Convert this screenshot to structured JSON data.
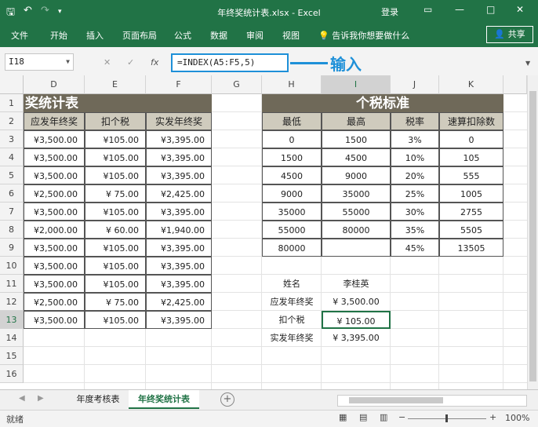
{
  "window": {
    "title": "年终奖统计表.xlsx - Excel",
    "login": "登录",
    "quick_access": [
      "save-icon",
      "undo-icon",
      "redo-icon",
      "customize-icon"
    ]
  },
  "ribbon": {
    "tabs": [
      "文件",
      "开始",
      "插入",
      "页面布局",
      "公式",
      "数据",
      "审阅",
      "视图"
    ],
    "tell_me": "告诉我你想要做什么",
    "share": "共享"
  },
  "formula_bar": {
    "name_box": "I18",
    "formula": "=INDEX(A5:F5,5)",
    "fx": "fx",
    "callout": "输入"
  },
  "columns": [
    "D",
    "E",
    "F",
    "G",
    "H",
    "I",
    "J",
    "K"
  ],
  "rows": [
    "1",
    "2",
    "3",
    "4",
    "5",
    "6",
    "7",
    "8",
    "9",
    "10",
    "11",
    "12",
    "13",
    "14",
    "15",
    "16"
  ],
  "left_table": {
    "banner": "奖统计表",
    "headers": [
      "应发年终奖",
      "扣个税",
      "实发年终奖"
    ],
    "rows": [
      [
        "¥3,500.00",
        "¥105.00",
        "¥3,395.00"
      ],
      [
        "¥3,500.00",
        "¥105.00",
        "¥3,395.00"
      ],
      [
        "¥3,500.00",
        "¥105.00",
        "¥3,395.00"
      ],
      [
        "¥2,500.00",
        "¥ 75.00",
        "¥2,425.00"
      ],
      [
        "¥3,500.00",
        "¥105.00",
        "¥3,395.00"
      ],
      [
        "¥2,000.00",
        "¥ 60.00",
        "¥1,940.00"
      ],
      [
        "¥3,500.00",
        "¥105.00",
        "¥3,395.00"
      ],
      [
        "¥3,500.00",
        "¥105.00",
        "¥3,395.00"
      ],
      [
        "¥3,500.00",
        "¥105.00",
        "¥3,395.00"
      ],
      [
        "¥2,500.00",
        "¥ 75.00",
        "¥2,425.00"
      ],
      [
        "¥3,500.00",
        "¥105.00",
        "¥3,395.00"
      ]
    ]
  },
  "tax_table": {
    "banner": "个税标准",
    "headers": [
      "最低",
      "最高",
      "税率",
      "速算扣除数"
    ],
    "rows": [
      [
        "0",
        "1500",
        "3%",
        "0"
      ],
      [
        "1500",
        "4500",
        "10%",
        "105"
      ],
      [
        "4500",
        "9000",
        "20%",
        "555"
      ],
      [
        "9000",
        "35000",
        "25%",
        "1005"
      ],
      [
        "35000",
        "55000",
        "30%",
        "2755"
      ],
      [
        "55000",
        "80000",
        "35%",
        "5505"
      ],
      [
        "80000",
        "",
        "45%",
        "13505"
      ]
    ]
  },
  "lookup": {
    "rows": [
      {
        "label": "姓名",
        "value": "李桂英"
      },
      {
        "label": "应发年终奖",
        "value": "¥ 3,500.00"
      },
      {
        "label": "扣个税",
        "value": "¥    105.00"
      },
      {
        "label": "实发年终奖",
        "value": "¥ 3,395.00"
      }
    ]
  },
  "sheets": {
    "tabs": [
      "年度考核表",
      "年终奖统计表"
    ],
    "active": "年终奖统计表"
  },
  "status": {
    "ready": "就绪",
    "zoom": "100%"
  }
}
